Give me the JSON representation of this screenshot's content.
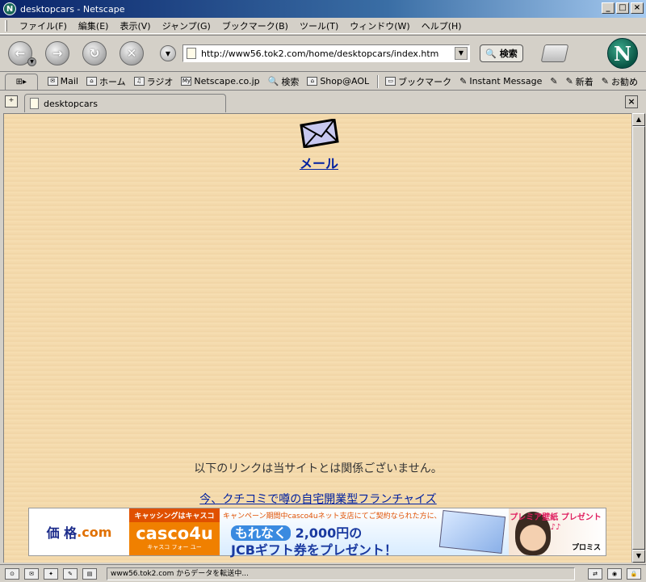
{
  "window": {
    "title": "desktopcars - Netscape"
  },
  "menu": [
    "ファイル(F)",
    "編集(E)",
    "表示(V)",
    "ジャンプ(G)",
    "ブックマーク(B)",
    "ツール(T)",
    "ウィンドウ(W)",
    "ヘルプ(H)"
  ],
  "navigation": {
    "url": "http://www56.tok2.com/home/desktopcars/index.htm",
    "search_label": "検索"
  },
  "personal_toolbar": [
    {
      "label": "Mail",
      "icon": "mail-icon"
    },
    {
      "label": "ホーム",
      "icon": "home-icon"
    },
    {
      "label": "ラジオ",
      "icon": "headphones-icon"
    },
    {
      "label": "Netscape.co.jp",
      "icon": "my-icon"
    },
    {
      "label": "検索",
      "icon": "search-icon"
    },
    {
      "label": "Shop@AOL",
      "icon": "shop-icon"
    },
    {
      "label": "ブックマーク",
      "icon": "folder-icon"
    },
    {
      "label": "Instant Message",
      "icon": "link-icon"
    },
    {
      "label": "",
      "icon": "link-icon"
    },
    {
      "label": "新着",
      "icon": "link-icon"
    },
    {
      "label": "お勧め",
      "icon": "link-icon"
    }
  ],
  "tabs": [
    {
      "label": "desktopcars"
    }
  ],
  "page": {
    "mail_label": "メール",
    "disclaimer": "以下のリンクは当サイトとは関係ございません。",
    "ad_link": "今、クチコミで噂の自宅開業型フランチャイズ"
  },
  "banner": {
    "kakaku": "価 格",
    "kakaku_com": ".com",
    "casco_top": "キャッシングはキャスコ",
    "casco_logo": "casco4u",
    "casco_sub": "キャスコ フォー ユー",
    "promo_line1": "キャンペーン期間中casco4uネット支店にてご契約なられた方に、",
    "promo_highlight": "もれなく",
    "promo_line2": "2,000円の",
    "promo_line3": "JCBギフト券をプレゼント！",
    "premium_text": "プレミア壁紙 プレゼント ♪♪",
    "brand": "プロミス"
  },
  "status": {
    "text": "www56.tok2.com からデータを転送中..."
  },
  "colors": {
    "link": "#0020a0",
    "page_bg": "#f5dcb0"
  }
}
